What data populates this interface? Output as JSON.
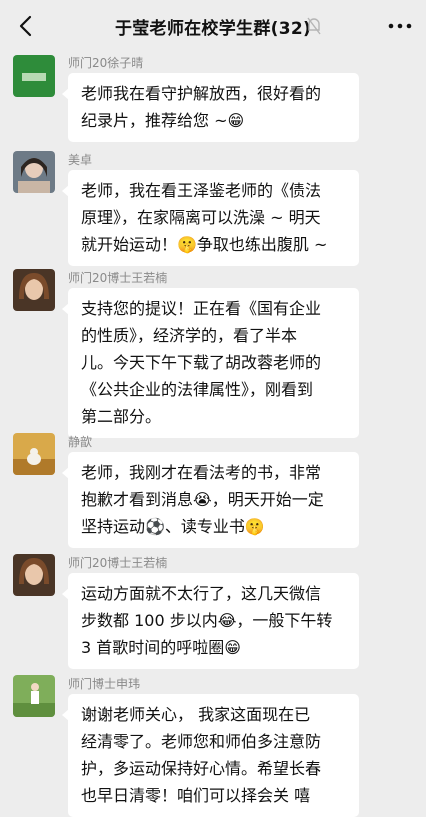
{
  "header": {
    "title": "于莹老师在校学生群(32)",
    "back_icon": "chevron-left-icon",
    "mute_icon": "bell-off-icon",
    "more_icon": "more-dots-icon"
  },
  "messages": [
    {
      "sender": "师门20徐子晴",
      "lines": [
        "老师我在看守护解放西，很好看的",
        "纪录片，推荐给您 ~😁"
      ]
    },
    {
      "sender": "美卓",
      "lines": [
        "老师，我在看王泽鉴老师的《债法",
        "原理》，在家隔离可以洗澡 ~ 明天",
        "就开始运动！🤫争取也练出腹肌 ~"
      ]
    },
    {
      "sender": "师门20博士王若楠",
      "lines": [
        "支持您的提议！正在看《国有企业",
        "的性质》，经济学的，看了半本",
        "儿。今天下午下载了胡改蓉老师的",
        "《公共企业的法律属性》，刚看到",
        "第二部分。"
      ]
    },
    {
      "sender": "静歆",
      "lines": [
        "老师，我刚才在看法考的书，非常",
        "抱歉才看到消息😭，明天开始一定",
        "坚持运动⚽、读专业书🤫"
      ]
    },
    {
      "sender": "师门20博士王若楠",
      "lines": [
        "运动方面就不太行了，这几天微信",
        "步数都 100 步以内😂，一般下午转",
        "3 首歌时间的呼啦圈😁"
      ]
    },
    {
      "sender": "师门博士申玮",
      "lines": [
        "谢谢老师关心，  我家这面现在已",
        "经清零了。老师您和师伯多注意防",
        "护，多运动保持好心情。希望长春",
        "也早日清零！咱们可以择会关 嘻"
      ]
    }
  ],
  "colors": {
    "background": "#ededed",
    "bubble": "#ffffff",
    "sender_name": "#8a8a8a"
  }
}
